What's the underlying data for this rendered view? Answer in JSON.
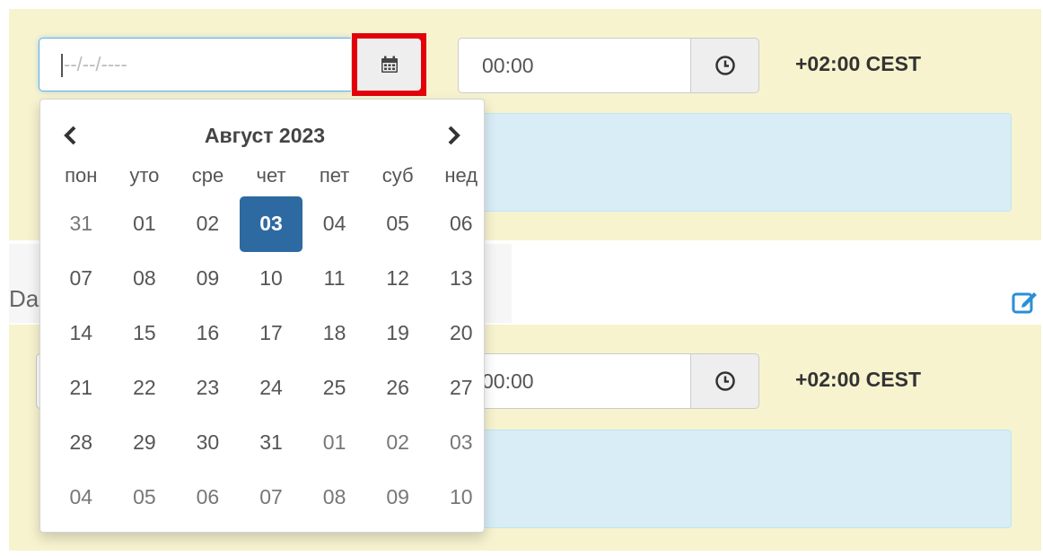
{
  "top_row": {
    "date_placeholder": "--/--/----",
    "time_value": "00:00",
    "timezone": "+02:00 CEST"
  },
  "bottom_row": {
    "time_value": "00:00",
    "timezone": "+02:00 CEST"
  },
  "section_label": "Da",
  "datepicker": {
    "title": "Август 2023",
    "weekdays": [
      "пон",
      "уто",
      "сре",
      "чет",
      "пет",
      "суб",
      "нед"
    ],
    "weeks": [
      [
        "31",
        "01",
        "02",
        "03",
        "04",
        "05",
        "06"
      ],
      [
        "07",
        "08",
        "09",
        "10",
        "11",
        "12",
        "13"
      ],
      [
        "14",
        "15",
        "16",
        "17",
        "18",
        "19",
        "20"
      ],
      [
        "21",
        "22",
        "23",
        "24",
        "25",
        "26",
        "27"
      ],
      [
        "28",
        "29",
        "30",
        "31",
        "01",
        "02",
        "03"
      ],
      [
        "04",
        "05",
        "06",
        "07",
        "08",
        "09",
        "10"
      ]
    ],
    "selected": "03"
  },
  "icons": {
    "calendar": "calendar-icon",
    "clock": "clock-icon",
    "prev": "chevron-left-icon",
    "next": "chevron-right-icon",
    "edit": "edit-icon"
  },
  "colors": {
    "highlight": "#e3000b",
    "selected_day": "#2d6aa1",
    "panel": "#f7f3cf",
    "info_box": "#d9edf7",
    "edit_icon": "#2a8fd6"
  }
}
